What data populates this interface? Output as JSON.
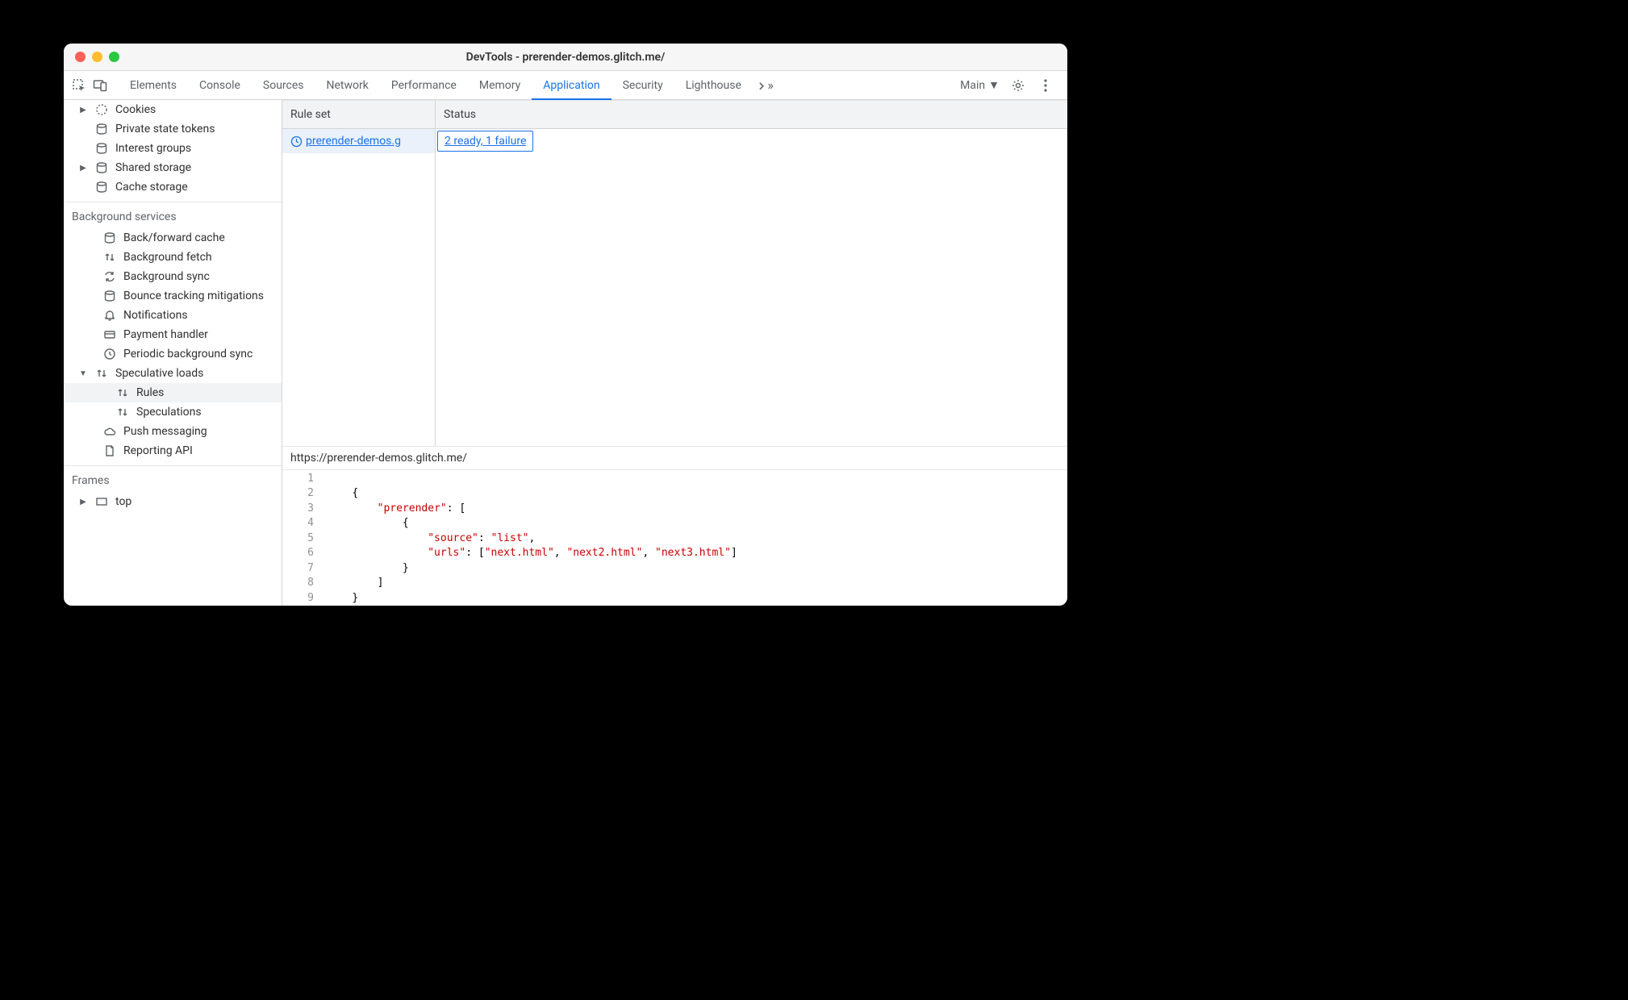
{
  "window": {
    "title": "DevTools - prerender-demos.glitch.me/"
  },
  "tabs": [
    "Elements",
    "Console",
    "Sources",
    "Network",
    "Performance",
    "Memory",
    "Application",
    "Security",
    "Lighthouse"
  ],
  "activeTabIndex": 6,
  "contextSelector": "Main",
  "sidebar": {
    "storage": [
      {
        "label": "Cookies",
        "indent": 0,
        "arrow": "▶",
        "icon": "cookie"
      },
      {
        "label": "Private state tokens",
        "indent": 0,
        "icon": "db"
      },
      {
        "label": "Interest groups",
        "indent": 0,
        "icon": "db"
      },
      {
        "label": "Shared storage",
        "indent": 0,
        "arrow": "▶",
        "icon": "db"
      },
      {
        "label": "Cache storage",
        "indent": 0,
        "icon": "db"
      }
    ],
    "bgSection": "Background services",
    "bg": [
      {
        "label": "Back/forward cache",
        "indent": 1,
        "icon": "db"
      },
      {
        "label": "Background fetch",
        "indent": 1,
        "icon": "ud"
      },
      {
        "label": "Background sync",
        "indent": 1,
        "icon": "sync"
      },
      {
        "label": "Bounce tracking mitigations",
        "indent": 1,
        "icon": "db"
      },
      {
        "label": "Notifications",
        "indent": 1,
        "icon": "bell"
      },
      {
        "label": "Payment handler",
        "indent": 1,
        "icon": "card"
      },
      {
        "label": "Periodic background sync",
        "indent": 1,
        "icon": "clock"
      },
      {
        "label": "Speculative loads",
        "indent": 0,
        "arrow": "▼",
        "icon": "ud"
      },
      {
        "label": "Rules",
        "indent": 2,
        "icon": "ud",
        "selected": true
      },
      {
        "label": "Speculations",
        "indent": 2,
        "icon": "ud"
      },
      {
        "label": "Push messaging",
        "indent": 1,
        "icon": "cloud"
      },
      {
        "label": "Reporting API",
        "indent": 1,
        "icon": "doc"
      }
    ],
    "framesSection": "Frames",
    "frames": [
      {
        "label": "top",
        "indent": 0,
        "arrow": "▶",
        "icon": "frame"
      }
    ]
  },
  "table": {
    "headers": {
      "ruleset": "Rule set",
      "status": "Status"
    },
    "rows": [
      {
        "ruleset": " prerender-demos.g",
        "status": "2 ready, 1 failure"
      }
    ]
  },
  "detail": {
    "url": "https://prerender-demos.glitch.me/",
    "lines": [
      1,
      2,
      3,
      4,
      5,
      6,
      7,
      8,
      9
    ],
    "json": {
      "key1": "prerender",
      "key2": "source",
      "val2": "list",
      "key3": "urls",
      "urls": [
        "next.html",
        "next2.html",
        "next3.html"
      ]
    }
  }
}
